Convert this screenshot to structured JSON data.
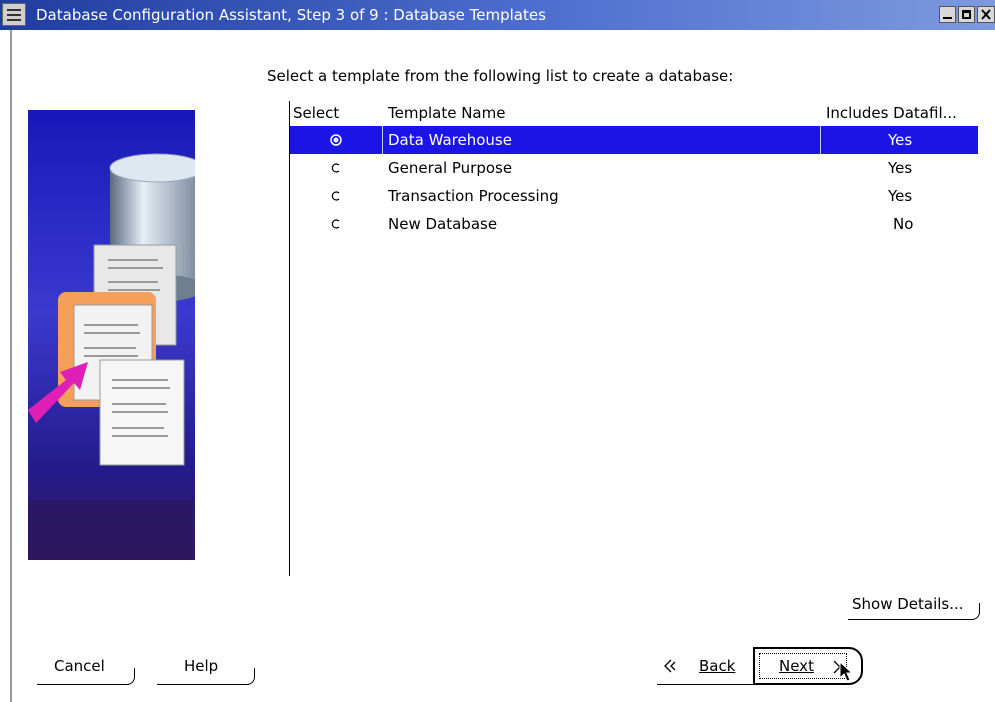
{
  "window": {
    "title": "Database Configuration Assistant, Step 3 of 9 : Database Templates"
  },
  "main": {
    "instruction": "Select a template from the following list to create a database:"
  },
  "table": {
    "headers": {
      "select": "Select",
      "name": "Template Name",
      "datafiles": "Includes Datafil..."
    },
    "rows": [
      {
        "name": "Data Warehouse",
        "datafiles": "Yes",
        "selected": true
      },
      {
        "name": "General Purpose",
        "datafiles": "Yes",
        "selected": false
      },
      {
        "name": "Transaction Processing",
        "datafiles": "Yes",
        "selected": false
      },
      {
        "name": "New Database",
        "datafiles": "No",
        "selected": false
      }
    ]
  },
  "buttons": {
    "show_details": "Show Details...",
    "cancel": "Cancel",
    "help": "Help",
    "back": "Back",
    "next": "Next"
  },
  "colors": {
    "titlebar": "#2f4fb8",
    "selection": "#1a14e6"
  },
  "icons": {
    "illustration": "database-templates-illustration",
    "back": "back-arrow-icon",
    "next": "next-arrow-icon"
  }
}
